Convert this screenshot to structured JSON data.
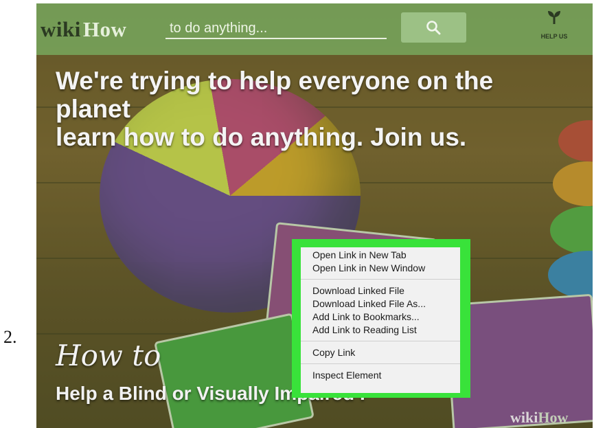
{
  "step": {
    "number": "2."
  },
  "header": {
    "logo_wiki": "wiki",
    "logo_how": "How",
    "search_placeholder": "to do anything...",
    "search_icon": "search-icon",
    "help_us_icon": "sprout-icon",
    "help_us_label": "HELP US"
  },
  "hero": {
    "line1": "We're trying to help everyone on the",
    "line2": "planet",
    "line3": "learn how to do anything. Join us."
  },
  "article": {
    "how_to": "How to",
    "title": "Help a Blind or Visually Impaired P"
  },
  "watermark": {
    "wiki": "wiki",
    "how": "How"
  },
  "context_menu": {
    "group1": [
      "Open Link in New Tab",
      "Open Link in New Window"
    ],
    "group2": [
      "Download Linked File",
      "Download Linked File As...",
      "Add Link to Bookmarks...",
      "Add Link to Reading List"
    ],
    "group3": [
      "Copy Link"
    ],
    "group4": [
      "Inspect Element"
    ]
  },
  "colors": {
    "highlight": "#39e23a",
    "header_bar": "#78aa5f",
    "menu_bg": "#f1f1f1"
  }
}
